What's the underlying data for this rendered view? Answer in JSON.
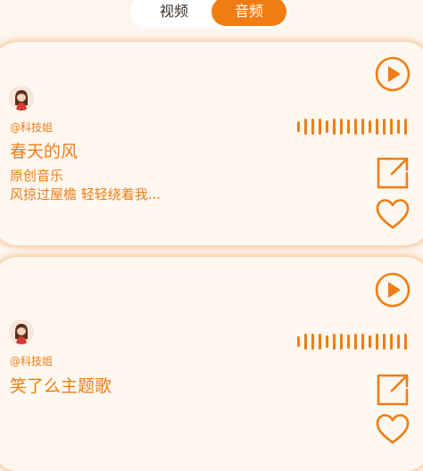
{
  "tabs": {
    "video_label": "视频",
    "audio_label": "音频",
    "active": "audio"
  },
  "colors": {
    "accent": "#f07d11",
    "background": "#fdf6ef",
    "card": "#fff8f1"
  },
  "icons": {
    "play": "play-circle-icon",
    "share": "share-external-icon",
    "like": "heart-outline-icon",
    "wave": "audio-waveform-icon"
  },
  "cards": [
    {
      "author": "@科技姐",
      "title": "春天的风",
      "subtitle": "原创音乐",
      "lyric": "风掠过屋檐 轻轻绕着我..."
    },
    {
      "author": "@科技姐",
      "title": "笑了么主题歌"
    }
  ]
}
